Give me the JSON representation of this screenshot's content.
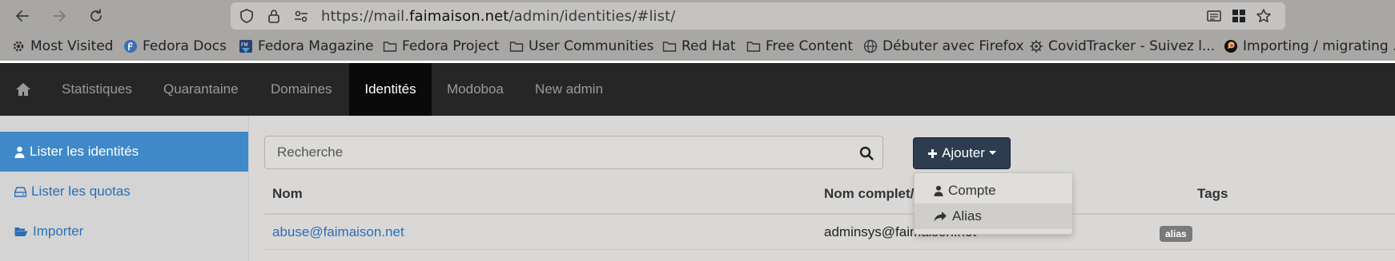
{
  "browser": {
    "url_prefix": "https://mail.",
    "url_domain": "faimaison.net",
    "url_path": "/admin/identities/#list/"
  },
  "bookmarks": [
    {
      "label": "Most Visited",
      "icon": "gear-icon"
    },
    {
      "label": "Fedora Docs",
      "icon": "fedora-icon"
    },
    {
      "label": "Fedora Magazine",
      "icon": "fedora-magazine-icon"
    },
    {
      "label": "Fedora Project",
      "icon": "folder-icon"
    },
    {
      "label": "User Communities",
      "icon": "folder-icon"
    },
    {
      "label": "Red Hat",
      "icon": "folder-icon"
    },
    {
      "label": "Free Content",
      "icon": "folder-icon"
    },
    {
      "label": "Débuter avec Firefox",
      "icon": "globe-icon"
    },
    {
      "label": "CovidTracker - Suivez l...",
      "icon": "virus-icon"
    },
    {
      "label": "Importing / migrating ...",
      "icon": "chat-icon"
    }
  ],
  "navbar": {
    "items": [
      "Statistiques",
      "Quarantaine",
      "Domaines",
      "Identités",
      "Modoboa",
      "New admin"
    ],
    "active": "Identités"
  },
  "sidebar": {
    "items": [
      "Lister les identités",
      "Lister les quotas",
      "Importer"
    ]
  },
  "search": {
    "placeholder": "Recherche"
  },
  "add_button": {
    "label": "Ajouter"
  },
  "dropdown": {
    "items": [
      "Compte",
      "Alias"
    ]
  },
  "table": {
    "headers": [
      "Nom",
      "Nom complet/D",
      "Tags"
    ],
    "rows": [
      {
        "name": "abuse@faimaison.net",
        "fullname": "adminsys@faimaison.net",
        "tag": "alias"
      }
    ]
  },
  "colors": {
    "navbar_bg": "#262626",
    "sidebar_active": "#3f89c8",
    "link": "#2a6fb3",
    "add_button_bg": "#2d3c4f"
  }
}
